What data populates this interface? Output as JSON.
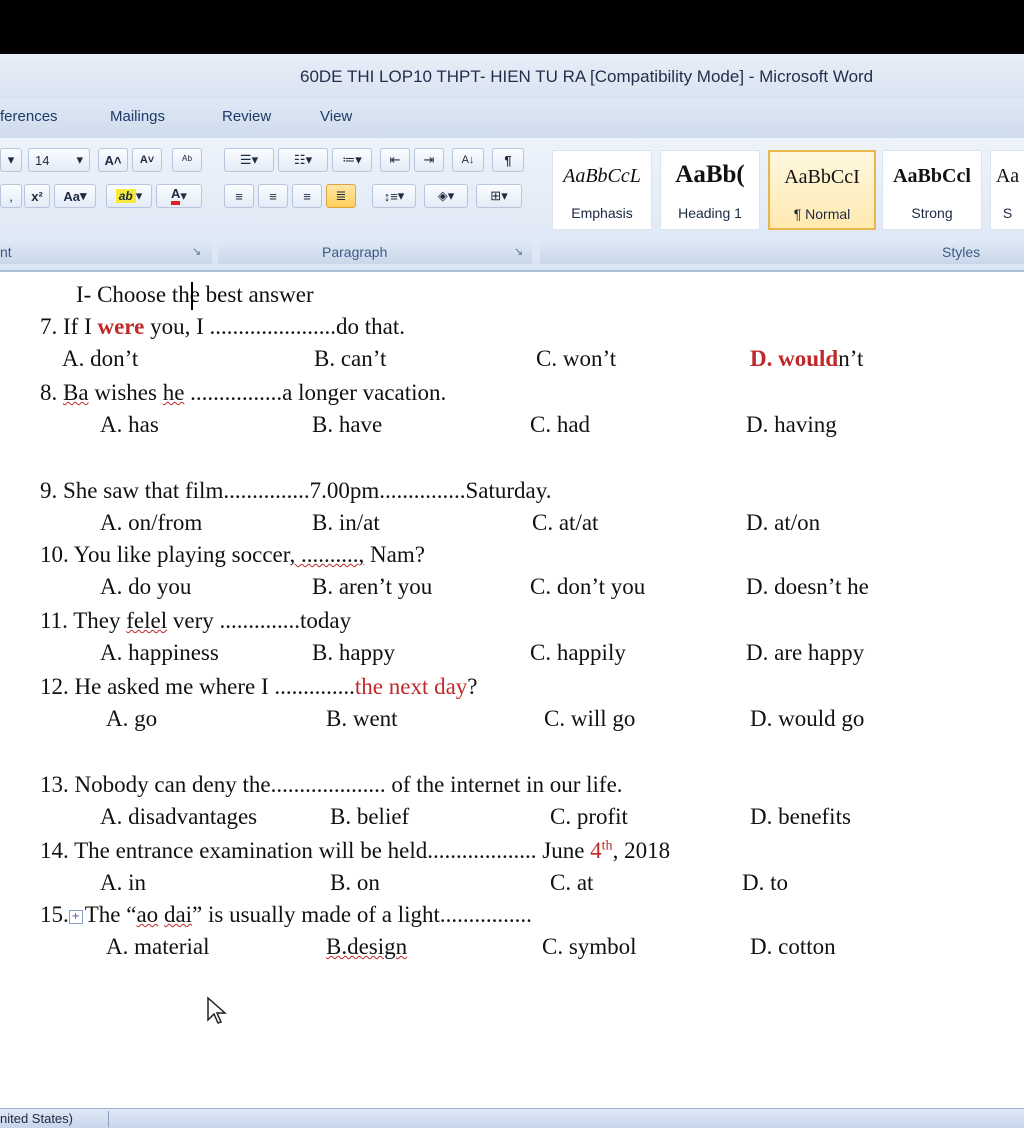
{
  "window": {
    "title": "60DE THI LOP10 THPT- HIEN TU RA [Compatibility Mode] - Microsoft Word"
  },
  "tabs": [
    "ferences",
    "Mailings",
    "Review",
    "View"
  ],
  "ribbon": {
    "font_size": "14",
    "grow_font": "A˄",
    "shrink_font": "A˅",
    "paragraph_label": "Paragraph",
    "font_group_label": "nt",
    "styles_label": "Styles",
    "styles": [
      {
        "sample": "AaBbCcL",
        "name": "Emphasis"
      },
      {
        "sample": "AaBb(",
        "name": "Heading 1"
      },
      {
        "sample": "AaBbCcI",
        "name": "¶ Normal"
      },
      {
        "sample": "AaBbCcl",
        "name": "Strong"
      },
      {
        "sample": "Aa",
        "name": "S"
      }
    ],
    "superscript_label": "x²",
    "change_case_label": "Aa",
    "pilcrow": "¶"
  },
  "document": {
    "heading": "I- Choose the best answer",
    "questions": [
      {
        "stem_pre": "7. If I ",
        "stem_red": "were",
        "stem_post": " you, I ......................do that.",
        "a": "A. don’t",
        "b": "B. can’t",
        "c": "C. won’t",
        "d_bold_red": "D. would",
        "d_rest": "n’t"
      },
      {
        "stem_pre": "8. ",
        "stem_wavy1": "Ba",
        "stem_mid": " wishes ",
        "stem_wavy2": "he",
        "stem_post": " ................a longer vacation.",
        "a": "A. has",
        "b": "B. have",
        "c": "C. had",
        "d": "D. having"
      },
      {
        "stem": "9. She saw that film...............7.00pm...............Saturday.",
        "a": "A. on/from",
        "b": "B. in/at",
        "c": "C. at/at",
        "d": "D. at/on"
      },
      {
        "stem_pre": "10. You like playing soccer",
        "stem_wavy": ", ..........,",
        "stem_post": " Nam?",
        "a": "A. do you",
        "b": "B. aren’t you",
        "c": "C. don’t you",
        "d": "D. doesn’t he"
      },
      {
        "stem_pre": "11. They ",
        "stem_wavy": "felel",
        "stem_post": " very ..............today",
        "a": "A. happiness",
        "b": "B. happy",
        "c": "C. happily",
        "d": "D. are happy"
      },
      {
        "stem_pre": "12. He asked me where I ..............",
        "stem_red": "the next day",
        "stem_post": "?",
        "a": "A. go",
        "b": "B. went",
        "c": "C. will go",
        "d": "D. would go"
      },
      {
        "stem": "13. Nobody can deny the.................... of the internet in our life.",
        "a": "A. disadvantages",
        "b": "B. belief",
        "c": "C. profit",
        "d": "D. benefits"
      },
      {
        "stem_pre": "14. The entrance examination will be held................... June ",
        "stem_red": "4",
        "stem_sup": "th",
        "stem_post": ", 2018",
        "a": "A. in",
        "b": "B. on",
        "c": "C. at",
        "d": "D. to"
      },
      {
        "stem_pre": "15.",
        "stem_post1": "The “",
        "stem_wavy1": "ao",
        "stem_sp": " ",
        "stem_wavy2": "dai",
        "stem_post2": "” is usually made of a light................",
        "a": "A. material",
        "b_wavy": "B.design",
        "c": "C. symbol",
        "d": "D. cotton"
      }
    ]
  },
  "status": {
    "language": "nited States)"
  },
  "colors": {
    "accent": "#c0282a",
    "ribbon": "#dbe6f4",
    "title": "#1f2f4a"
  }
}
